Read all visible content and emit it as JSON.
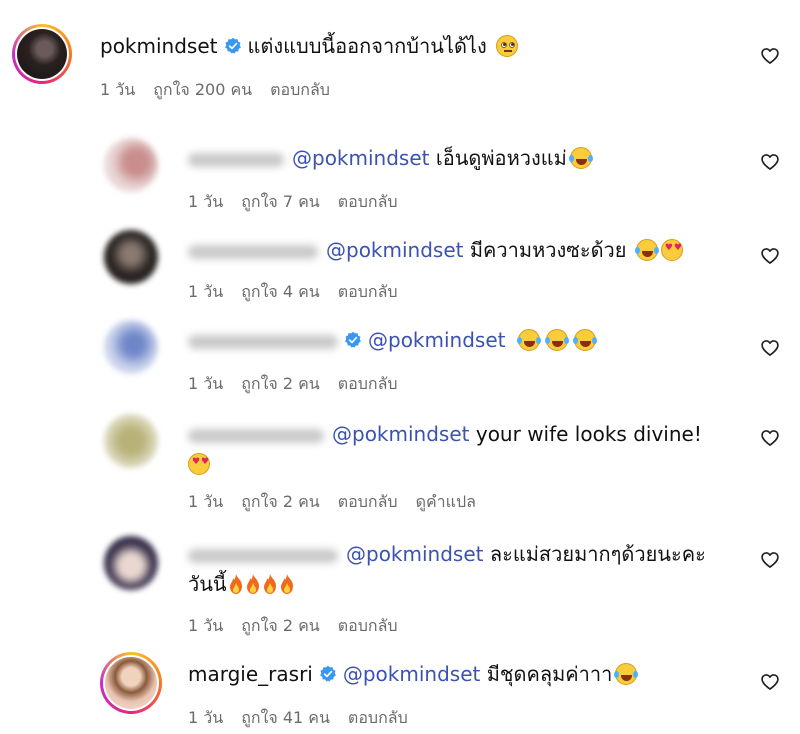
{
  "comments": [
    {
      "username": "pokmindset",
      "verified": true,
      "mention": "",
      "text": "แต่งแบบนี้ออกจากบ้านได้ไง",
      "text2": "",
      "time": "1 วัน",
      "likes": "ถูกใจ 200 คน",
      "reply": "ตอบกลับ",
      "translate": ""
    },
    {
      "username": "",
      "verified": false,
      "mention": "@pokmindset",
      "text": "เอ็นดูพ่อหวงแม่",
      "text2": "",
      "time": "1 วัน",
      "likes": "ถูกใจ 7 คน",
      "reply": "ตอบกลับ",
      "translate": ""
    },
    {
      "username": "",
      "verified": false,
      "mention": "@pokmindset",
      "text": "มีความหวงซะด้วย",
      "text2": "",
      "time": "1 วัน",
      "likes": "ถูกใจ 4 คน",
      "reply": "ตอบกลับ",
      "translate": ""
    },
    {
      "username": "",
      "verified": true,
      "mention": "@pokmindset",
      "text": "",
      "text2": "",
      "time": "1 วัน",
      "likes": "ถูกใจ 2 คน",
      "reply": "ตอบกลับ",
      "translate": ""
    },
    {
      "username": "",
      "verified": false,
      "mention": "@pokmindset",
      "text": "your wife looks divine!",
      "text2": "",
      "time": "1 วัน",
      "likes": "ถูกใจ 2 คน",
      "reply": "ตอบกลับ",
      "translate": "ดูคำแปล"
    },
    {
      "username": "",
      "verified": false,
      "mention": "@pokmindset",
      "text": "ละแม่สวยมากๆด้วยนะคะ",
      "text2": "วันนี้",
      "time": "1 วัน",
      "likes": "ถูกใจ 2 คน",
      "reply": "ตอบกลับ",
      "translate": ""
    },
    {
      "username": "margie_rasri",
      "verified": true,
      "mention": "@pokmindset",
      "text": "มีชุดคลุมค่าาา",
      "text2": "",
      "time": "1 วัน",
      "likes": "ถูกใจ 41 คน",
      "reply": "ตอบกลับ",
      "translate": ""
    }
  ],
  "colors": {
    "mention": "#3b52b5",
    "verified": "#3897f0",
    "meta": "#6b6b6b"
  },
  "icons": {
    "like": "heart-outline-icon",
    "verified": "verified-badge-icon"
  }
}
